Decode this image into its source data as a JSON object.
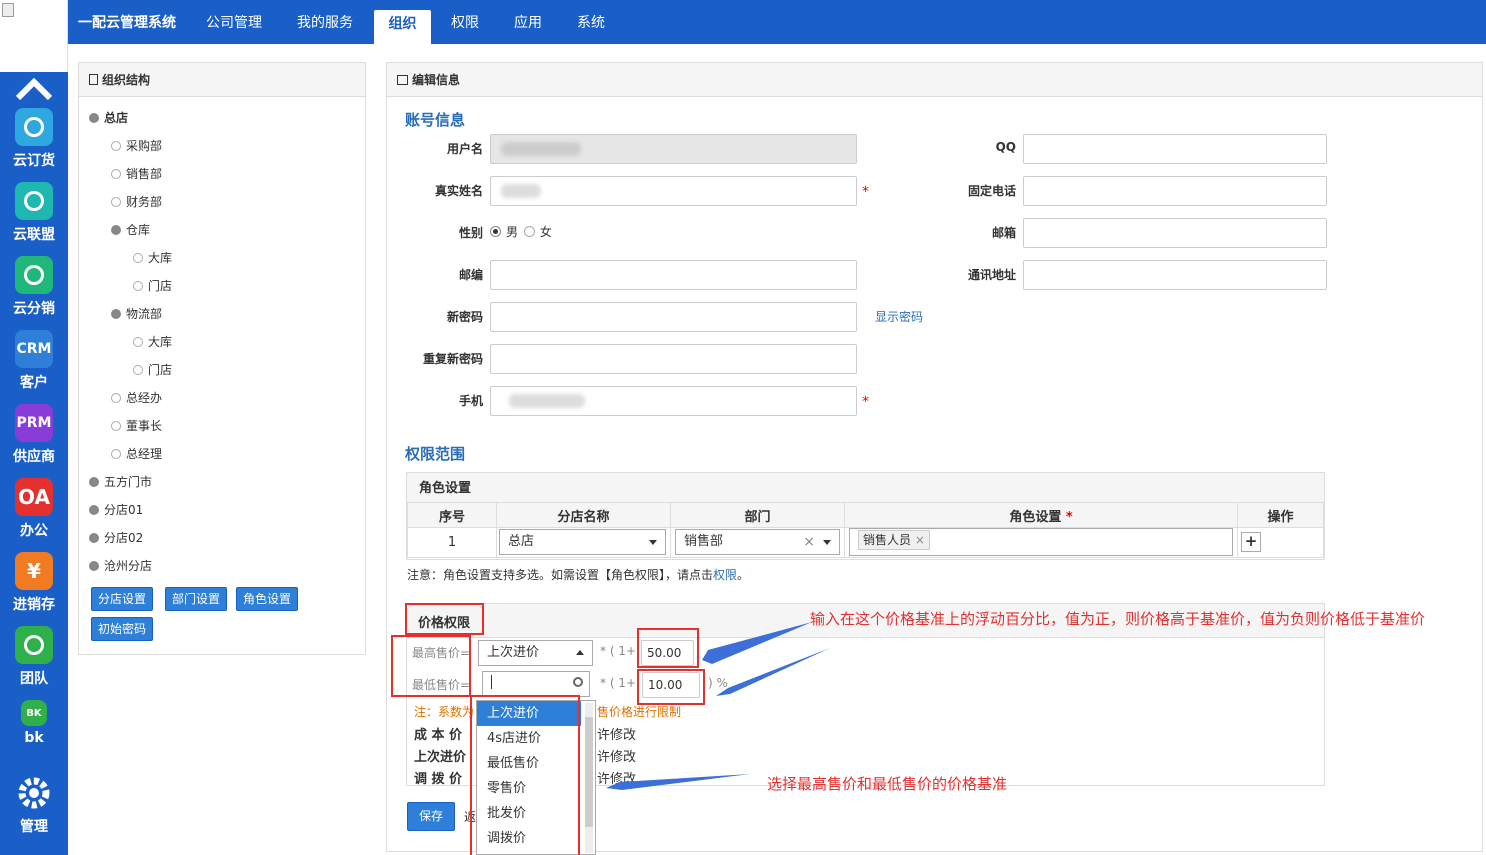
{
  "topnav": {
    "brand": "一配云管理系统",
    "items": [
      "公司管理",
      "我的服务",
      "组织",
      "权限",
      "应用",
      "系统"
    ],
    "active": "组织"
  },
  "sidebar": {
    "apps": [
      {
        "label": "云订货",
        "icon": "cloud-order-icon",
        "color": "#2fa8e0",
        "text": ""
      },
      {
        "label": "云联盟",
        "icon": "handshake-icon",
        "color": "#1fb8b0",
        "text": ""
      },
      {
        "label": "云分销",
        "icon": "network-icon",
        "color": "#1fb87a",
        "text": ""
      },
      {
        "label": "客户",
        "icon": "crm-icon",
        "color": "#2e7fd8",
        "text": "CRM"
      },
      {
        "label": "供应商",
        "icon": "prm-icon",
        "color": "#8a3cd8",
        "text": "PRM"
      },
      {
        "label": "办公",
        "icon": "oa-icon",
        "color": "#e53030",
        "text": "OA"
      },
      {
        "label": "进销存",
        "icon": "yen-icon",
        "color": "#f07b22",
        "text": "¥"
      },
      {
        "label": "团队",
        "icon": "team-icon",
        "color": "#2fb04a",
        "text": ""
      },
      {
        "label": "bk",
        "icon": "bk-icon",
        "color": "#2fb04a",
        "text": "BK"
      },
      {
        "label": "管理",
        "icon": "gear-icon",
        "color": "transparent",
        "text": ""
      }
    ]
  },
  "org": {
    "title": "组织结构",
    "tree": [
      "总店",
      "采购部",
      "销售部",
      "财务部",
      "仓库",
      "大库",
      "门店",
      "物流部",
      "大库",
      "门店",
      "总经办",
      "董事长",
      "总经理",
      "五方门市",
      "分店01",
      "分店02",
      "沧州分店"
    ],
    "buttons": [
      "分店设置",
      "部门设置",
      "角色设置",
      "初始密码"
    ]
  },
  "edit": {
    "title": "编辑信息",
    "account_section": "账号信息",
    "labels": {
      "username": "用户名",
      "realname": "真实姓名",
      "gender": "性别",
      "zip": "邮编",
      "newpwd": "新密码",
      "repwd": "重复新密码",
      "mobile": "手机",
      "qq": "QQ",
      "phone": "固定电话",
      "email": "邮箱",
      "address": "通讯地址"
    },
    "gender_male": "男",
    "gender_female": "女",
    "show_pwd": "显示密码",
    "required": "*",
    "scope_section": "权限范围",
    "role_title": "角色设置",
    "role_headers": [
      "序号",
      "分店名称",
      "部门",
      "角色设置",
      "操作"
    ],
    "role_row": {
      "index": "1",
      "store": "总店",
      "dept": "销售部",
      "role_tag": "销售人员"
    },
    "role_note_a": "注意：角色设置支持多选。如需设置【角色权限】，请点击",
    "role_note_link": "权限",
    "role_note_b": "。",
    "price_section": "价格权限",
    "max_label": "最高售价=",
    "min_label": "最低售价=",
    "max_base": "上次进价",
    "formula": "* ( 1+",
    "max_pct": "50.00",
    "min_pct": "10.00",
    "pct_suffix": ") %",
    "price_note": "注：系数为",
    "price_note2": "售价格进行限制",
    "rows": [
      {
        "k": "成 本 价",
        "v": "许修改"
      },
      {
        "k": "上次进价",
        "v": "许修改"
      },
      {
        "k": "调 拨 价",
        "v": "许修改"
      }
    ],
    "options": [
      "上次进价",
      "4s店进价",
      "最低售价",
      "零售价",
      "批发价",
      "调拨价"
    ],
    "save": "保存"
  },
  "annotations": {
    "top": "输入在这个价格基准上的浮动百分比，值为正，则价格高于基准价，值为负则价格低于基准价",
    "bottom": "选择最高售价和最低售价的价格基准"
  }
}
